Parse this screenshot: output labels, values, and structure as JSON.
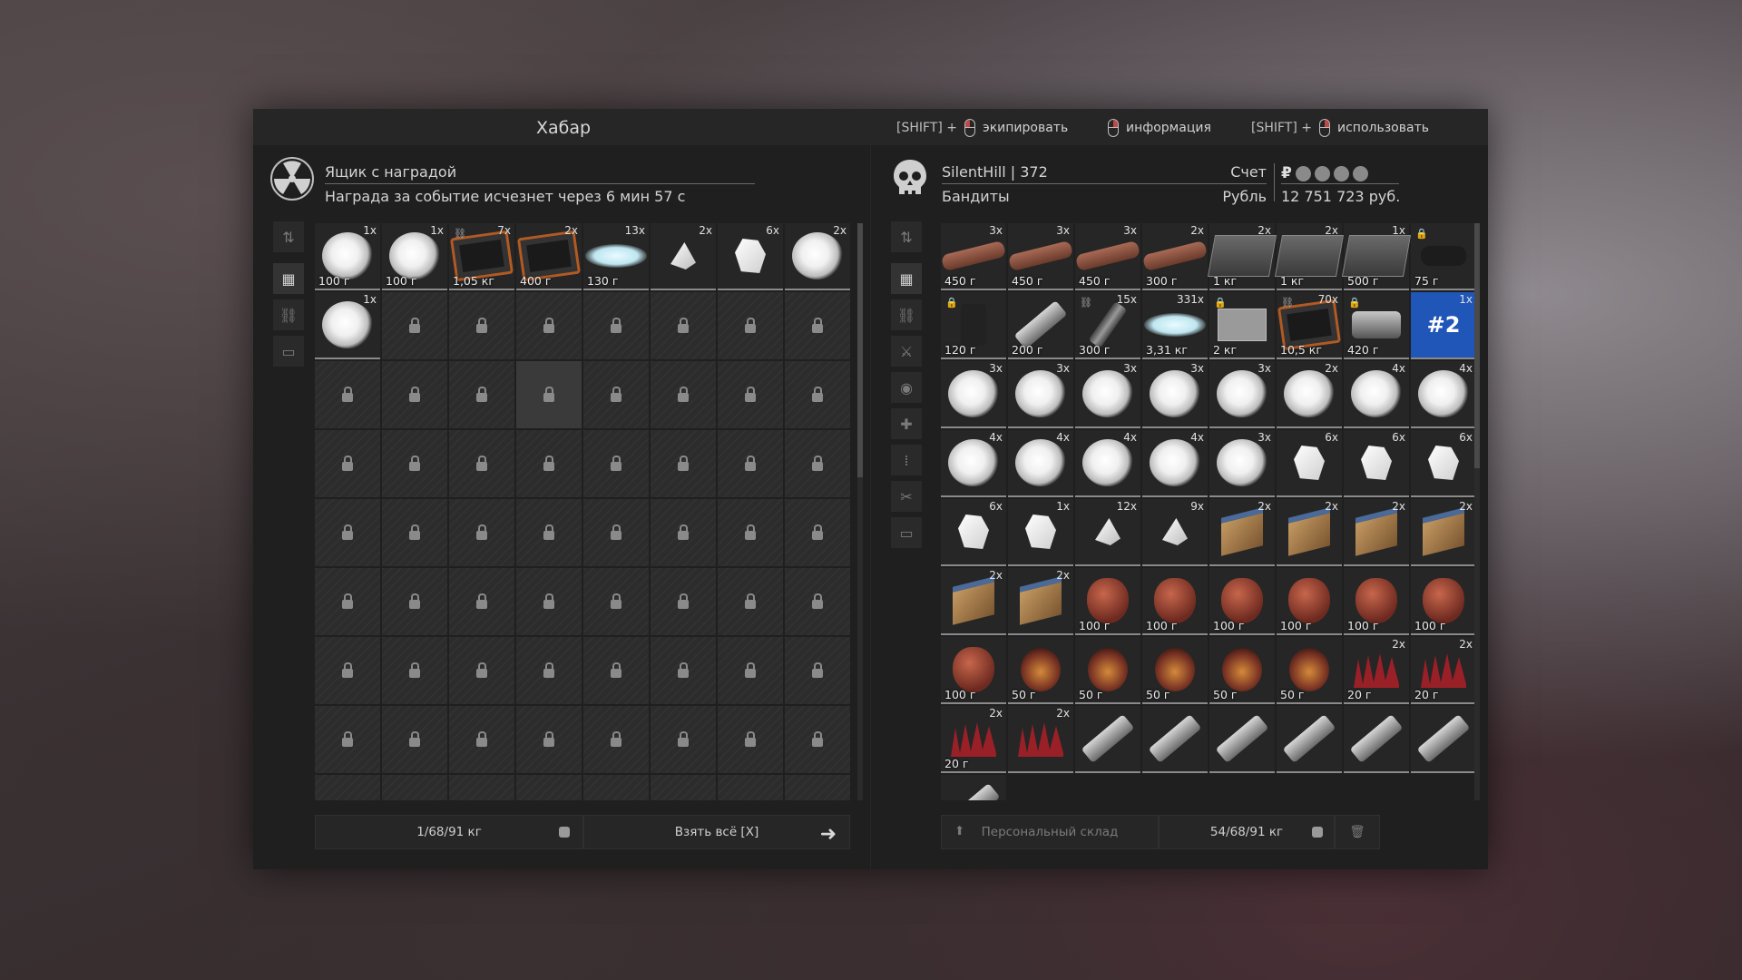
{
  "header": {
    "title": "Хабар",
    "hints": [
      {
        "prefix": "[SHIFT] +",
        "mouse": "left",
        "label": "экипировать"
      },
      {
        "prefix": "",
        "mouse": "right",
        "label": "информация"
      },
      {
        "prefix": "[SHIFT] +",
        "mouse": "right",
        "label": "использовать"
      }
    ]
  },
  "left_panel": {
    "name": "Ящик с наградой",
    "subtitle": "Награда за событие исчезнет через 6 мин 57 с",
    "emblem_icon": "radiation-icon",
    "sidebar": [
      "sort-icon",
      "grid-icon",
      "link-icon",
      "archive-icon"
    ],
    "items": [
      {
        "kind": "cloud",
        "count": "1x",
        "value": "100 г"
      },
      {
        "kind": "cloud",
        "count": "1x",
        "value": "100 г"
      },
      {
        "kind": "case",
        "count": "7x",
        "value": "1,05 кг",
        "linked": true
      },
      {
        "kind": "case",
        "count": "2x",
        "value": "400 г"
      },
      {
        "kind": "powder",
        "count": "13x",
        "value": "130 г"
      },
      {
        "kind": "shard",
        "count": "2x",
        "value": ""
      },
      {
        "kind": "crystal",
        "count": "6x",
        "value": ""
      },
      {
        "kind": "cloud",
        "count": "2x",
        "value": ""
      },
      {
        "kind": "cloud",
        "count": "1x",
        "value": ""
      }
    ],
    "locked_cells": 63,
    "footer": {
      "weight": "1/68/91 кг",
      "take_all": "Взять всё [X]"
    }
  },
  "right_panel": {
    "player": "SilentHill",
    "player_sep": "|",
    "player_id": "372",
    "faction": "Бандиты",
    "account_label": "Счет",
    "currency_label": "Рубль",
    "currency_symbol": "₽",
    "balance": "12 751 723 руб.",
    "emblem_icon": "skull-icon",
    "sidebar": [
      "sort-icon",
      "grid-icon",
      "link-icon",
      "knife-icon",
      "artifact-icon",
      "medkit-icon",
      "ammo-icon",
      "tools-icon",
      "archive-icon"
    ],
    "items": [
      {
        "kind": "bone",
        "count": "3x",
        "value": "450 г"
      },
      {
        "kind": "bone",
        "count": "3x",
        "value": "450 г"
      },
      {
        "kind": "bone",
        "count": "3x",
        "value": "450 г"
      },
      {
        "kind": "bone",
        "count": "2x",
        "value": "300 г"
      },
      {
        "kind": "crate",
        "count": "2x",
        "value": "1 кг"
      },
      {
        "kind": "crate",
        "count": "2x",
        "value": "1 кг"
      },
      {
        "kind": "crate",
        "count": "1x",
        "value": "500 г"
      },
      {
        "kind": "scope",
        "count": "",
        "value": "75 г",
        "locked": true
      },
      {
        "kind": "grip",
        "count": "",
        "value": "120 г",
        "locked": true
      },
      {
        "kind": "tube",
        "count": "",
        "value": "200 г"
      },
      {
        "kind": "cable",
        "count": "15x",
        "value": "300 г",
        "linked": true
      },
      {
        "kind": "powder",
        "count": "331x",
        "value": "3,31 кг"
      },
      {
        "kind": "pad",
        "count": "",
        "value": "2 кг",
        "locked": true
      },
      {
        "kind": "case",
        "count": "70x",
        "value": "10,5 кг",
        "linked": true
      },
      {
        "kind": "device",
        "count": "",
        "value": "420 г",
        "locked": true
      },
      {
        "kind": "tag",
        "count": "1x",
        "value": "",
        "tag": "#2"
      },
      {
        "kind": "cloud",
        "count": "3x",
        "value": ""
      },
      {
        "kind": "cloud",
        "count": "3x",
        "value": ""
      },
      {
        "kind": "cloud",
        "count": "3x",
        "value": ""
      },
      {
        "kind": "cloud",
        "count": "3x",
        "value": ""
      },
      {
        "kind": "cloud",
        "count": "3x",
        "value": ""
      },
      {
        "kind": "cloud",
        "count": "2x",
        "value": ""
      },
      {
        "kind": "cloud",
        "count": "4x",
        "value": ""
      },
      {
        "kind": "cloud",
        "count": "4x",
        "value": ""
      },
      {
        "kind": "cloud",
        "count": "4x",
        "value": ""
      },
      {
        "kind": "cloud",
        "count": "4x",
        "value": ""
      },
      {
        "kind": "cloud",
        "count": "4x",
        "value": ""
      },
      {
        "kind": "cloud",
        "count": "4x",
        "value": ""
      },
      {
        "kind": "cloud",
        "count": "3x",
        "value": ""
      },
      {
        "kind": "crystal",
        "count": "6x",
        "value": ""
      },
      {
        "kind": "crystal",
        "count": "6x",
        "value": ""
      },
      {
        "kind": "crystal",
        "count": "6x",
        "value": ""
      },
      {
        "kind": "crystal",
        "count": "6x",
        "value": ""
      },
      {
        "kind": "crystal",
        "count": "1x",
        "value": ""
      },
      {
        "kind": "shard",
        "count": "12x",
        "value": ""
      },
      {
        "kind": "shard",
        "count": "9x",
        "value": ""
      },
      {
        "kind": "box",
        "count": "2x",
        "value": ""
      },
      {
        "kind": "box",
        "count": "2x",
        "value": ""
      },
      {
        "kind": "box",
        "count": "2x",
        "value": ""
      },
      {
        "kind": "box",
        "count": "2x",
        "value": ""
      },
      {
        "kind": "box",
        "count": "2x",
        "value": ""
      },
      {
        "kind": "box",
        "count": "2x",
        "value": ""
      },
      {
        "kind": "heart",
        "count": "",
        "value": "100 г"
      },
      {
        "kind": "heart",
        "count": "",
        "value": "100 г"
      },
      {
        "kind": "heart",
        "count": "",
        "value": "100 г"
      },
      {
        "kind": "heart",
        "count": "",
        "value": "100 г"
      },
      {
        "kind": "heart",
        "count": "",
        "value": "100 г"
      },
      {
        "kind": "heart",
        "count": "",
        "value": "100 г"
      },
      {
        "kind": "heart",
        "count": "",
        "value": "100 г"
      },
      {
        "kind": "gland",
        "count": "",
        "value": "50 г"
      },
      {
        "kind": "gland",
        "count": "",
        "value": "50 г"
      },
      {
        "kind": "gland",
        "count": "",
        "value": "50 г"
      },
      {
        "kind": "gland",
        "count": "",
        "value": "50 г"
      },
      {
        "kind": "gland",
        "count": "",
        "value": "50 г"
      },
      {
        "kind": "spikes",
        "count": "2x",
        "value": "20 г"
      },
      {
        "kind": "spikes",
        "count": "2x",
        "value": "20 г"
      },
      {
        "kind": "spikes",
        "count": "2x",
        "value": "20 г"
      },
      {
        "kind": "spikes",
        "count": "2x",
        "value": ""
      },
      {
        "kind": "tube",
        "count": "",
        "value": ""
      },
      {
        "kind": "tube",
        "count": "",
        "value": ""
      },
      {
        "kind": "tube",
        "count": "",
        "value": ""
      },
      {
        "kind": "tube",
        "count": "",
        "value": ""
      },
      {
        "kind": "tube",
        "count": "",
        "value": ""
      },
      {
        "kind": "tube",
        "count": "",
        "value": ""
      },
      {
        "kind": "tube",
        "count": "",
        "value": ""
      }
    ],
    "footer": {
      "storage": "Персональный склад",
      "weight": "54/68/91 кг"
    }
  }
}
